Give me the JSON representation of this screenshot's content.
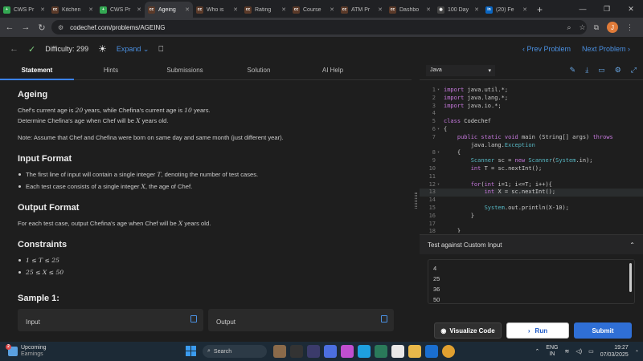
{
  "browser": {
    "tabs": [
      {
        "label": "CWS Pr",
        "fav_color": "#34a853",
        "fav": "+"
      },
      {
        "label": "Kitchen",
        "fav_color": "#5b3a29",
        "fav": "cc"
      },
      {
        "label": "CWS Pr",
        "fav_color": "#34a853",
        "fav": "+"
      },
      {
        "label": "Ageing",
        "fav_color": "#5b3a29",
        "fav": "cc",
        "active": true
      },
      {
        "label": "Who is",
        "fav_color": "#5b3a29",
        "fav": "cc"
      },
      {
        "label": "Rating",
        "fav_color": "#5b3a29",
        "fav": "cc"
      },
      {
        "label": "Course",
        "fav_color": "#5b3a29",
        "fav": "cc"
      },
      {
        "label": "ATM Pr",
        "fav_color": "#5b3a29",
        "fav": "cc"
      },
      {
        "label": "Dashbo",
        "fav_color": "#5b3a29",
        "fav": "cc"
      },
      {
        "label": "100 Day",
        "fav_color": "#444",
        "fav": "◉"
      },
      {
        "label": "(20) Fe",
        "fav_color": "#0a66c2",
        "fav": "in"
      }
    ],
    "url": "codechef.com/problems/AGEING",
    "profile_initial": "J"
  },
  "topbar": {
    "difficulty": "Difficulty: 299",
    "expand": "Expand",
    "prev": "Prev Problem",
    "next": "Next Problem"
  },
  "left_tabs": [
    "Statement",
    "Hints",
    "Submissions",
    "Solution",
    "AI Help"
  ],
  "problem": {
    "title": "Ageing",
    "line1_a": "Chef's current age is ",
    "line1_n1": "20",
    "line1_b": " years, while Chefina's current age is ",
    "line1_n2": "10",
    "line1_c": " years.",
    "line2_a": "Determine Chefina's age when Chef will be ",
    "line2_var": "X",
    "line2_b": " years old.",
    "note": "Note: Assume that Chef and Chefina were born on same day and same month (just different year).",
    "input_title": "Input Format",
    "input_1a": "The first line of input will contain a single integer ",
    "input_1var": "T",
    "input_1b": ", denoting the number of test cases.",
    "input_2a": "Each test case consists of a single integer ",
    "input_2var": "X",
    "input_2b": ", the age of Chef.",
    "output_title": "Output Format",
    "output_a": "For each test case, output Chefina's age when Chef will be ",
    "output_var": "X",
    "output_b": " years old.",
    "constraints_title": "Constraints",
    "c1": "1 ≤ T ≤ 25",
    "c2": "25 ≤ X ≤ 50",
    "sample_title": "Sample 1:",
    "sample_input": "Input",
    "sample_output": "Output"
  },
  "editor": {
    "language": "Java",
    "lines": [
      {
        "n": "1",
        "f": "▾",
        "t": "import java.util.*;"
      },
      {
        "n": "2",
        "f": "",
        "t": "import java.lang.*;"
      },
      {
        "n": "3",
        "f": "",
        "t": "import java.io.*;"
      },
      {
        "n": "4",
        "f": "",
        "t": ""
      },
      {
        "n": "5",
        "f": "",
        "t": "class Codechef"
      },
      {
        "n": "6",
        "f": "▾",
        "t": "{"
      },
      {
        "n": "7",
        "f": "",
        "t": "    public static void main (String[] args) throws"
      },
      {
        "n": "",
        "f": "",
        "t": "        java.lang.Exception"
      },
      {
        "n": "8",
        "f": "▾",
        "t": "    {"
      },
      {
        "n": "9",
        "f": "",
        "t": "        Scanner sc = new Scanner(System.in);"
      },
      {
        "n": "10",
        "f": "",
        "t": "        int T = sc.nextInt();"
      },
      {
        "n": "11",
        "f": "",
        "t": ""
      },
      {
        "n": "12",
        "f": "▾",
        "t": "        for(int i=1; i<=T; i++){"
      },
      {
        "n": "13",
        "f": "",
        "t": "            int X = sc.nextInt();",
        "hl": true
      },
      {
        "n": "14",
        "f": "",
        "t": ""
      },
      {
        "n": "15",
        "f": "",
        "t": "            System.out.println(X-10);"
      },
      {
        "n": "16",
        "f": "",
        "t": "        }"
      },
      {
        "n": "17",
        "f": "",
        "t": ""
      },
      {
        "n": "18",
        "f": "",
        "t": "    }"
      }
    ]
  },
  "custom": {
    "title": "Test against Custom Input",
    "values": [
      "4",
      "25",
      "36",
      "50"
    ]
  },
  "buttons": {
    "visualize": "Visualize Code",
    "run": "Run",
    "submit": "Submit"
  },
  "taskbar": {
    "weather_title": "Upcoming",
    "weather_sub": "Earnings",
    "weather_badge": "2",
    "search": "Search",
    "lang1": "ENG",
    "lang2": "IN",
    "time": "19:27",
    "date": "07/03/2025"
  }
}
